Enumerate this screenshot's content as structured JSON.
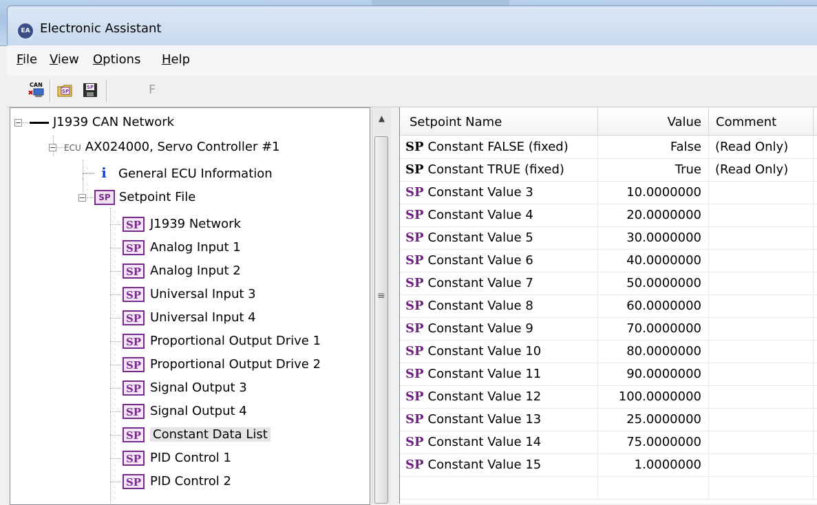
{
  "window": {
    "title": "Electronic Assistant",
    "app_icon_text": "EA"
  },
  "menu": {
    "items": [
      {
        "first": "F",
        "rest": "ile"
      },
      {
        "first": "V",
        "rest": "iew"
      },
      {
        "first": "O",
        "rest": "ptions"
      },
      {
        "first": "H",
        "rest": "elp"
      }
    ]
  },
  "toolbar": {
    "icons": [
      "can-connect-icon",
      "open-setpoint-icon",
      "save-setpoint-icon"
    ],
    "can_label": "CAN",
    "sp_label": "SP",
    "f_label": "F"
  },
  "tree": {
    "root": "J1939 CAN Network",
    "ecu_tag": "ECU",
    "ecu": "AX024000, Servo Controller #1",
    "general_info": "General ECU Information",
    "info_glyph": "i",
    "setpoint_file": "Setpoint File",
    "sp_glyph": "SP",
    "items": [
      "J1939 Network",
      "Analog Input 1",
      "Analog Input 2",
      "Universal Input 3",
      "Universal Input 4",
      "Proportional Output Drive 1",
      "Proportional Output Drive 2",
      "Signal Output 3",
      "Signal Output 4",
      "Constant Data List",
      "PID Control 1",
      "PID Control 2"
    ],
    "selected_item": "Constant Data List"
  },
  "table": {
    "columns": [
      "Setpoint Name",
      "Value",
      "Comment"
    ],
    "rows": [
      {
        "name": "Constant FALSE (fixed)",
        "value": "False",
        "comment": "(Read Only)",
        "badge": "black"
      },
      {
        "name": "Constant TRUE (fixed)",
        "value": "True",
        "comment": "(Read Only)",
        "badge": "black"
      },
      {
        "name": "Constant Value 3",
        "value": "10.0000000",
        "comment": "",
        "badge": "purple"
      },
      {
        "name": "Constant Value 4",
        "value": "20.0000000",
        "comment": "",
        "badge": "purple"
      },
      {
        "name": "Constant Value 5",
        "value": "30.0000000",
        "comment": "",
        "badge": "purple"
      },
      {
        "name": "Constant Value 6",
        "value": "40.0000000",
        "comment": "",
        "badge": "purple"
      },
      {
        "name": "Constant Value 7",
        "value": "50.0000000",
        "comment": "",
        "badge": "purple"
      },
      {
        "name": "Constant Value 8",
        "value": "60.0000000",
        "comment": "",
        "badge": "purple"
      },
      {
        "name": "Constant Value 9",
        "value": "70.0000000",
        "comment": "",
        "badge": "purple"
      },
      {
        "name": "Constant Value 10",
        "value": "80.0000000",
        "comment": "",
        "badge": "purple"
      },
      {
        "name": "Constant Value 11",
        "value": "90.0000000",
        "comment": "",
        "badge": "purple"
      },
      {
        "name": "Constant Value 12",
        "value": "100.0000000",
        "comment": "",
        "badge": "purple"
      },
      {
        "name": "Constant Value 13",
        "value": "25.0000000",
        "comment": "",
        "badge": "purple"
      },
      {
        "name": "Constant Value 14",
        "value": "75.0000000",
        "comment": "",
        "badge": "purple"
      },
      {
        "name": "Constant Value 15",
        "value": "1.0000000",
        "comment": "",
        "badge": "purple"
      }
    ]
  },
  "colors": {
    "sp_purple": "#6b1f7f",
    "info_blue": "#1a3fcf",
    "selection": "#e5e5e5"
  }
}
